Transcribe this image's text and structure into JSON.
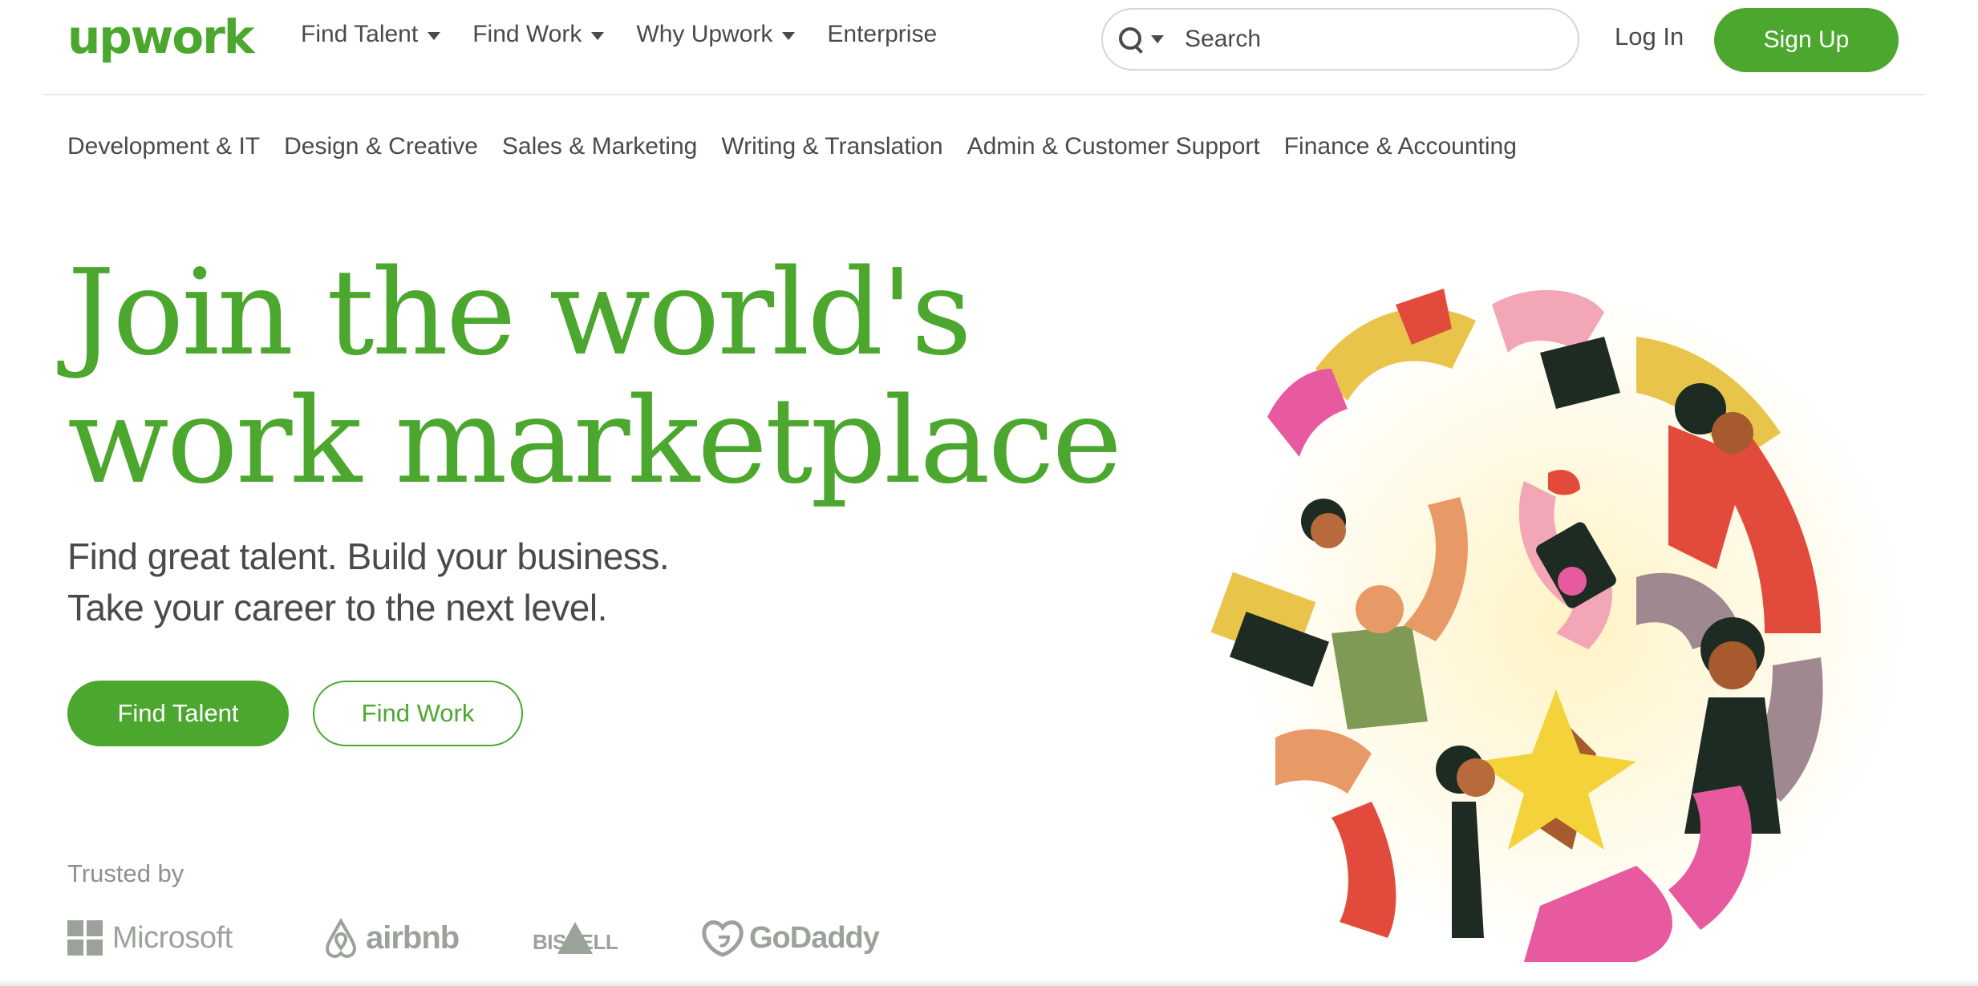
{
  "header": {
    "logo": "upwork",
    "nav": [
      {
        "label": "Find Talent",
        "has_caret": true
      },
      {
        "label": "Find Work",
        "has_caret": true
      },
      {
        "label": "Why Upwork",
        "has_caret": true
      },
      {
        "label": "Enterprise",
        "has_caret": false
      }
    ],
    "search": {
      "placeholder": "Search",
      "icon": "search-icon"
    },
    "login_label": "Log In",
    "signup_label": "Sign Up"
  },
  "categories": [
    "Development & IT",
    "Design & Creative",
    "Sales & Marketing",
    "Writing & Translation",
    "Admin & Customer Support",
    "Finance & Accounting"
  ],
  "hero": {
    "title_line1": "Join the world's",
    "title_line2": "work marketplace",
    "subtitle_line1": "Find great talent. Build your business.",
    "subtitle_line2": "Take your career to the next level.",
    "primary_cta": "Find Talent",
    "secondary_cta": "Find Work"
  },
  "trusted": {
    "label": "Trusted by",
    "brands": [
      "Microsoft",
      "airbnb",
      "BISSELL",
      "GoDaddy"
    ]
  },
  "colors": {
    "brand_green": "#4ca72e",
    "text_gray": "#4a4a4a",
    "logo_gray": "#9aa29a"
  }
}
